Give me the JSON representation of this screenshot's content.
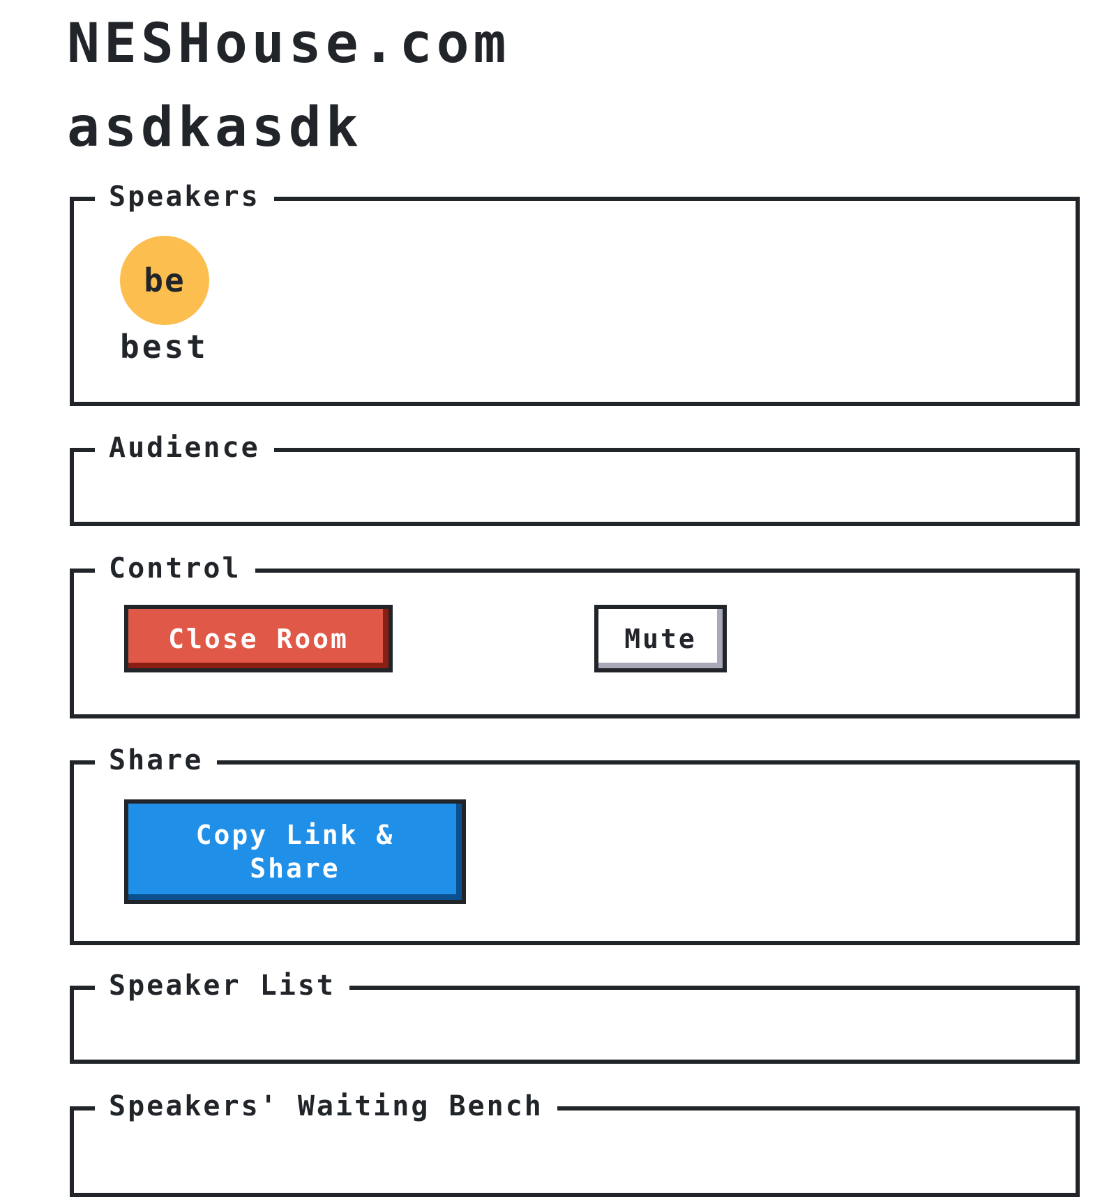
{
  "header": {
    "site_title": "NESHouse.com",
    "room_title": "asdkasdk"
  },
  "sections": {
    "speakers": {
      "title": "Speakers",
      "items": [
        {
          "initials": "be",
          "name": "best",
          "avatar_color": "#fbbe4f"
        }
      ]
    },
    "audience": {
      "title": "Audience"
    },
    "control": {
      "title": "Control",
      "close_room_label": "Close Room",
      "mute_label": "Mute"
    },
    "share": {
      "title": "Share",
      "copy_link_label": "Copy Link & Share"
    },
    "speaker_list": {
      "title": "Speaker List"
    },
    "waiting_bench": {
      "title": "Speakers' Waiting Bench"
    }
  },
  "colors": {
    "text": "#212529",
    "border": "#212529",
    "danger": "#e05847",
    "primary": "#208fe8",
    "avatar": "#fbbe4f"
  }
}
